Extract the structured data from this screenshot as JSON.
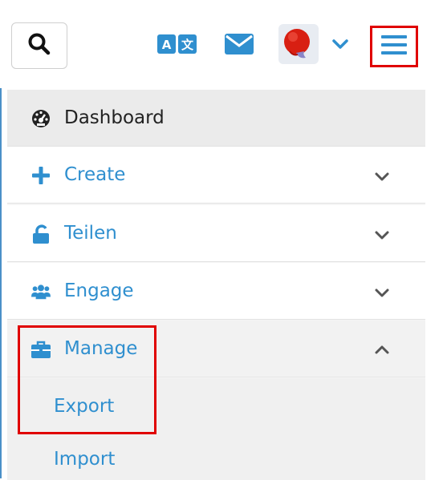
{
  "header": {
    "search_icon": "search-icon",
    "translate_icon": "translate-icon",
    "mail_icon": "envelope-icon",
    "avatar_icon": "avatar",
    "caret_icon": "chevron-down-icon",
    "menu_icon": "hamburger-icon",
    "translate_glyph_left": "A",
    "translate_glyph_right": "文"
  },
  "menu": {
    "items": [
      {
        "label": "Dashboard",
        "icon": "dashboard-icon",
        "expanded": null
      },
      {
        "label": "Create",
        "icon": "plus-icon",
        "expanded": false
      },
      {
        "label": "Teilen",
        "icon": "unlock-icon",
        "expanded": false
      },
      {
        "label": "Engage",
        "icon": "users-icon",
        "expanded": false
      },
      {
        "label": "Manage",
        "icon": "briefcase-icon",
        "expanded": true
      }
    ],
    "manage_submenu": [
      {
        "label": "Export"
      },
      {
        "label": "Import"
      }
    ]
  },
  "colors": {
    "accent_blue": "#2f8fcf",
    "highlight_red": "#e00000",
    "dashboard_bg": "#ebebeb",
    "text_dark": "#222222"
  }
}
